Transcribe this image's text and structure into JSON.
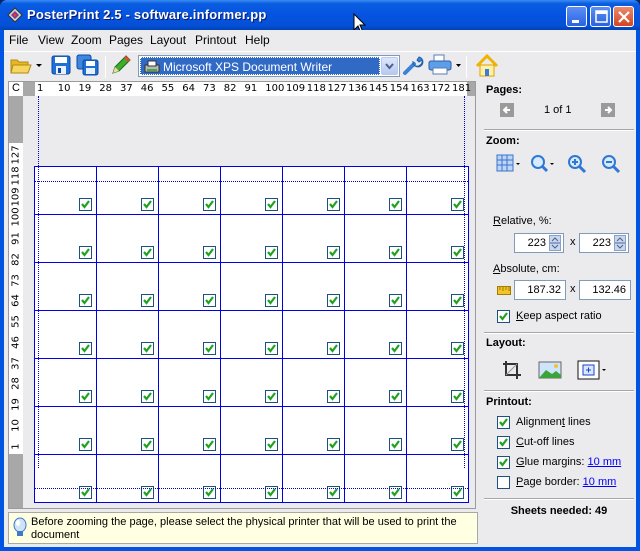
{
  "window": {
    "title": "PosterPrint 2.5 - software.informer.pp",
    "buttons": {
      "minimize": "minimize",
      "maximize": "maximize",
      "close": "close"
    }
  },
  "menu": [
    "File",
    "View",
    "Zoom",
    "Pages",
    "Layout",
    "Printout",
    "Help"
  ],
  "toolbar": {
    "open_icon": "folder-open-icon",
    "save_icon": "save-icon",
    "save_all_icon": "save-all-icon",
    "edit_icon": "pencil-icon",
    "printer_selected": "Microsoft XPS Document Writer",
    "settings_icon": "wrench-icon",
    "print_icon": "printer-icon",
    "home_icon": "home-icon"
  },
  "ruler": {
    "corner": "C",
    "horizontal": [
      "1",
      "10",
      "19",
      "28",
      "37",
      "46",
      "55",
      "64",
      "73",
      "82",
      "91",
      "100",
      "109",
      "118",
      "127",
      "136",
      "145",
      "154",
      "163",
      "172",
      "181"
    ],
    "vertical": [
      "127",
      "118",
      "109",
      "100",
      "91",
      "82",
      "73",
      "64",
      "55",
      "46",
      "37",
      "28",
      "19",
      "10",
      "1"
    ]
  },
  "sheet_grid": {
    "columns": 7,
    "rows": 7,
    "all_selected": true
  },
  "status": {
    "icon": "lightbulb-icon",
    "message": "Before zooming the page, please select the physical printer that will be used to print the document"
  },
  "panel": {
    "pages": {
      "title": "Pages:",
      "indicator": "1 of 1",
      "prev_icon": "arrow-left-icon",
      "next_icon": "arrow-right-icon"
    },
    "zoom": {
      "title": "Zoom:",
      "relative_label": "Relative, %:",
      "relative_w": "223",
      "relative_h": "223",
      "absolute_label": "Absolute, cm:",
      "absolute_w": "187.32",
      "absolute_h": "132.46",
      "times": "x",
      "keep_aspect_label": "Keep aspect ratio",
      "keep_aspect_checked": true
    },
    "layout": {
      "title": "Layout:"
    },
    "printout": {
      "title": "Printout:",
      "alignment_lines": {
        "label": "Alignment lines",
        "checked": true
      },
      "cutoff_lines": {
        "label": "Cut-off lines",
        "checked": true
      },
      "glue_margins": {
        "label": "Glue margins:",
        "value": "10 mm",
        "checked": true
      },
      "page_border": {
        "label": "Page border:",
        "value": "10 mm",
        "checked": false
      }
    },
    "sheets_needed": "Sheets needed: 49"
  },
  "colors": {
    "grid_line": "#0000e0",
    "check": "#1fa01f",
    "titlebar": "#0553e1",
    "status_bg": "#ffffe1"
  }
}
